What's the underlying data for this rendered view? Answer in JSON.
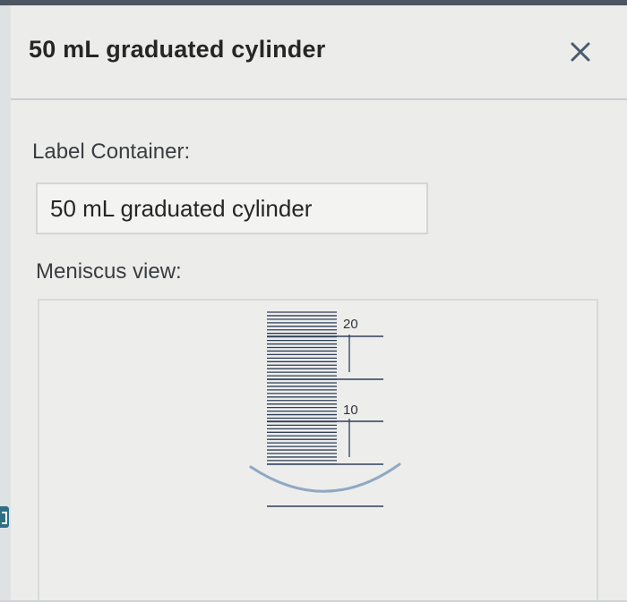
{
  "dialog": {
    "title": "50 mL graduated cylinder",
    "close_icon": "close-icon"
  },
  "label_container": {
    "label": "Label Container:",
    "value": "50 mL graduated cylinder"
  },
  "meniscus_view": {
    "label": "Meniscus view:",
    "scale_labels": [
      "20",
      "10"
    ],
    "colors": {
      "scale": "#2f3f58",
      "meniscus": "#8fa9c2"
    }
  }
}
